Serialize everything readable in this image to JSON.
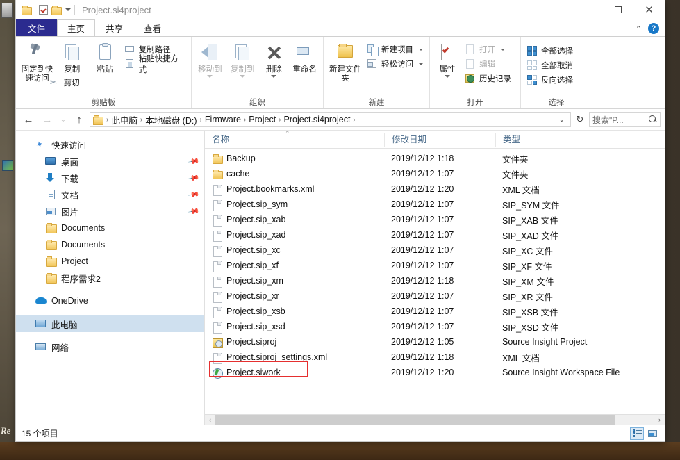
{
  "window": {
    "title": "Project.si4project",
    "controls": {
      "minimize": "–",
      "maximize": "□",
      "close": "✕"
    }
  },
  "quick_access_toolbar": {
    "items": [
      {
        "name": "folder-icon",
        "label": ""
      },
      {
        "name": "properties-icon",
        "label": ""
      },
      {
        "name": "new-folder-icon",
        "label": ""
      },
      {
        "name": "customize-dropdown",
        "label": ""
      }
    ]
  },
  "ribbon": {
    "tabs": [
      {
        "label": "文件",
        "id": "file"
      },
      {
        "label": "主页",
        "id": "home",
        "active": true
      },
      {
        "label": "共享",
        "id": "share"
      },
      {
        "label": "查看",
        "id": "view"
      }
    ],
    "collapse_chevron": "⌃",
    "help_label": "?",
    "groups": [
      {
        "title": "剪贴板",
        "big_buttons": [
          {
            "label": "固定到快速访问",
            "icon": "pin-icon"
          },
          {
            "label": "复制",
            "icon": "copy-icon"
          },
          {
            "label": "粘贴",
            "icon": "paste-icon"
          }
        ],
        "small_buttons": [
          {
            "label": "复制路径",
            "icon": "copy-path-icon"
          },
          {
            "label": "粘贴快捷方式",
            "icon": "paste-shortcut-icon"
          },
          {
            "label": "剪切",
            "icon": "scissors-icon"
          }
        ]
      },
      {
        "title": "组织",
        "big_buttons": [
          {
            "label": "移动到",
            "icon": "move-to-icon",
            "dim": true
          },
          {
            "label": "复制到",
            "icon": "copy-to-icon",
            "dim": true
          },
          {
            "label": "删除",
            "icon": "delete-icon"
          },
          {
            "label": "重命名",
            "icon": "rename-icon"
          }
        ]
      },
      {
        "title": "新建",
        "big_buttons": [
          {
            "label": "新建文件夹",
            "icon": "new-folder-icon"
          }
        ],
        "small_buttons": [
          {
            "label": "新建项目",
            "icon": "new-item-icon"
          },
          {
            "label": "轻松访问",
            "icon": "easy-access-icon"
          }
        ]
      },
      {
        "title": "打开",
        "big_buttons": [
          {
            "label": "属性",
            "icon": "properties-icon"
          }
        ],
        "small_buttons": [
          {
            "label": "打开",
            "icon": "open-icon",
            "dim": true
          },
          {
            "label": "编辑",
            "icon": "edit-icon",
            "dim": true
          },
          {
            "label": "历史记录",
            "icon": "history-icon"
          }
        ]
      },
      {
        "title": "选择",
        "small_buttons": [
          {
            "label": "全部选择",
            "icon": "select-all-icon"
          },
          {
            "label": "全部取消",
            "icon": "select-none-icon"
          },
          {
            "label": "反向选择",
            "icon": "invert-selection-icon"
          }
        ]
      }
    ]
  },
  "address_bar": {
    "back": "←",
    "forward": "→",
    "recent_caret": "⌄",
    "up": "↑",
    "breadcrumbs": [
      "此电脑",
      "本地磁盘 (D:)",
      "Firmware",
      "Project",
      "Project.si4project"
    ],
    "separator": "›",
    "dropdown_caret": "⌄",
    "refresh": "↻",
    "search_placeholder": "搜索\"P..."
  },
  "nav_pane": {
    "items": [
      {
        "label": "快速访问",
        "icon": "star-icon",
        "indent": false,
        "pinned": false
      },
      {
        "label": "桌面",
        "icon": "desktop-icon",
        "indent": true,
        "pinned": true
      },
      {
        "label": "下载",
        "icon": "downloads-icon",
        "indent": true,
        "pinned": true
      },
      {
        "label": "文档",
        "icon": "documents-icon",
        "indent": true,
        "pinned": true
      },
      {
        "label": "图片",
        "icon": "pictures-icon",
        "indent": true,
        "pinned": true
      },
      {
        "label": "Documents",
        "icon": "folder-icon",
        "indent": true,
        "pinned": false
      },
      {
        "label": "Documents",
        "icon": "folder-icon",
        "indent": true,
        "pinned": false
      },
      {
        "label": "Project",
        "icon": "folder-icon",
        "indent": true,
        "pinned": false
      },
      {
        "label": "程序需求2",
        "icon": "folder-icon",
        "indent": true,
        "pinned": false
      },
      {
        "label": "OneDrive",
        "icon": "cloud-icon",
        "indent": false,
        "pinned": false,
        "gap_before": true
      },
      {
        "label": "此电脑",
        "icon": "this-pc-icon",
        "indent": false,
        "pinned": false,
        "gap_before": true,
        "selected": true
      },
      {
        "label": "网络",
        "icon": "network-icon",
        "indent": false,
        "pinned": false,
        "gap_before": true
      }
    ]
  },
  "file_list": {
    "columns": [
      "名称",
      "修改日期",
      "类型"
    ],
    "sort_indicator": "⌃",
    "rows": [
      {
        "name": "Backup",
        "date": "2019/12/12 1:18",
        "type": "文件夹",
        "icon": "folder-icon"
      },
      {
        "name": "cache",
        "date": "2019/12/12 1:07",
        "type": "文件夹",
        "icon": "folder-icon"
      },
      {
        "name": "Project.bookmarks.xml",
        "date": "2019/12/12 1:20",
        "type": "XML 文档",
        "icon": "file-icon"
      },
      {
        "name": "Project.sip_sym",
        "date": "2019/12/12 1:07",
        "type": "SIP_SYM 文件",
        "icon": "file-icon"
      },
      {
        "name": "Project.sip_xab",
        "date": "2019/12/12 1:07",
        "type": "SIP_XAB 文件",
        "icon": "file-icon"
      },
      {
        "name": "Project.sip_xad",
        "date": "2019/12/12 1:07",
        "type": "SIP_XAD 文件",
        "icon": "file-icon"
      },
      {
        "name": "Project.sip_xc",
        "date": "2019/12/12 1:07",
        "type": "SIP_XC 文件",
        "icon": "file-icon"
      },
      {
        "name": "Project.sip_xf",
        "date": "2019/12/12 1:07",
        "type": "SIP_XF 文件",
        "icon": "file-icon"
      },
      {
        "name": "Project.sip_xm",
        "date": "2019/12/12 1:18",
        "type": "SIP_XM 文件",
        "icon": "file-icon"
      },
      {
        "name": "Project.sip_xr",
        "date": "2019/12/12 1:07",
        "type": "SIP_XR 文件",
        "icon": "file-icon"
      },
      {
        "name": "Project.sip_xsb",
        "date": "2019/12/12 1:07",
        "type": "SIP_XSB 文件",
        "icon": "file-icon"
      },
      {
        "name": "Project.sip_xsd",
        "date": "2019/12/12 1:07",
        "type": "SIP_XSD 文件",
        "icon": "file-icon"
      },
      {
        "name": "Project.siproj",
        "date": "2019/12/12 1:05",
        "type": "Source Insight Project",
        "icon": "siproj-icon"
      },
      {
        "name": "Project.siproj_settings.xml",
        "date": "2019/12/12 1:18",
        "type": "XML 文档",
        "icon": "file-icon"
      },
      {
        "name": "Project.siwork",
        "date": "2019/12/12 1:20",
        "type": "Source Insight Workspace File",
        "icon": "siwork-icon",
        "annotated": true
      }
    ]
  },
  "status_bar": {
    "item_count": "15 个项目",
    "views": [
      {
        "name": "details-view-button",
        "active": true
      },
      {
        "name": "large-icons-view-button",
        "active": false
      }
    ]
  },
  "scrollbar": {
    "left_arrow": "‹",
    "right_arrow": "›"
  },
  "desktop": {
    "watermark": "Re"
  },
  "colors": {
    "file_tab": "#2b2b8f",
    "selection": "#cfe0ef",
    "annotation": "#e52f2f",
    "header_text": "#4a6b8a"
  }
}
